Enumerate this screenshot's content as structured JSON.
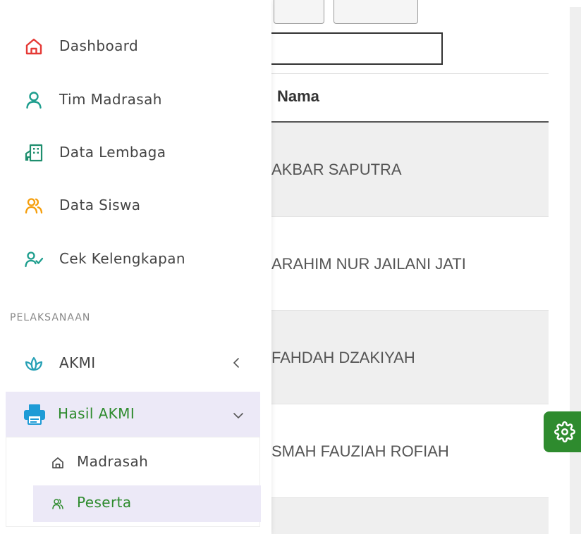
{
  "main": {
    "table": {
      "column_header": "Nama",
      "rows": [
        "AKBAR SAPUTRA",
        "ARAHIM NUR JAILANI JATI",
        "FAHDAH DZAKIYAH",
        "SMAH FAUZIAH ROFIAH"
      ]
    }
  },
  "sidebar": {
    "items": [
      {
        "label": "Dashboard",
        "icon": "home-icon",
        "color": "#e53935"
      },
      {
        "label": "Tim Madrasah",
        "icon": "user-icon",
        "color": "#1e9e8e"
      },
      {
        "label": "Data Lembaga",
        "icon": "building-icon",
        "color": "#1e8e6e"
      },
      {
        "label": "Data Siswa",
        "icon": "users-icon",
        "color": "#f59e0b"
      },
      {
        "label": "Cek Kelengkapan",
        "icon": "user-check-icon",
        "color": "#1e9e8e"
      }
    ],
    "section_title": "PELAKSANAAN",
    "akmi": {
      "label": "AKMI",
      "icon": "lotus-icon",
      "color": "#26a0b5"
    },
    "hasil_akmi": {
      "label": "Hasil AKMI",
      "icon": "printer-icon",
      "color": "#1e9bd6",
      "submenu": [
        {
          "label": "Madrasah",
          "icon": "home-icon"
        },
        {
          "label": "Peserta",
          "icon": "users-icon"
        }
      ]
    }
  },
  "colors": {
    "accent_green": "#2e8b2e",
    "active_bg": "#ece9f7"
  }
}
